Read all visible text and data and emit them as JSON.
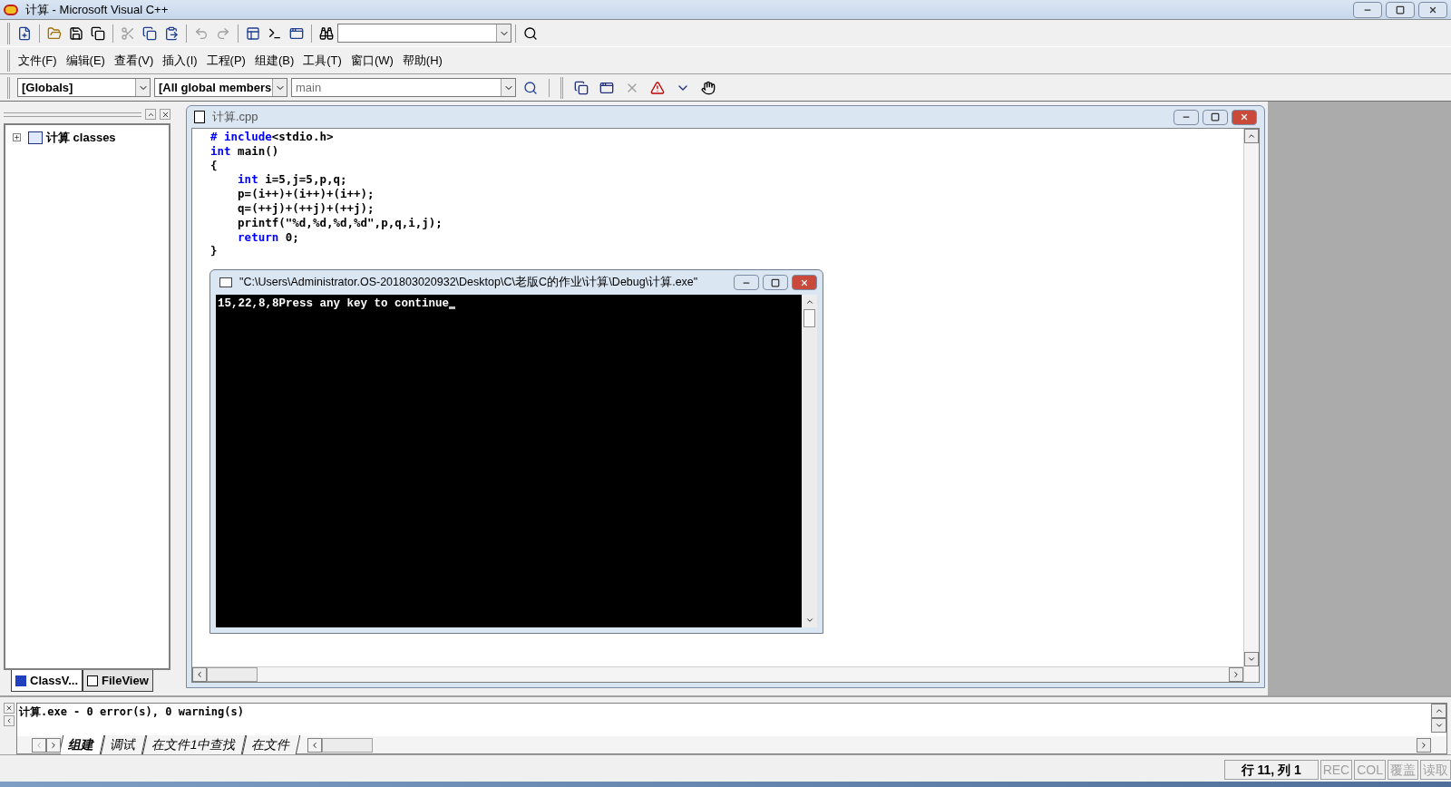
{
  "window": {
    "title": "计算 - Microsoft Visual C++"
  },
  "menu": [
    {
      "label": "文件(F)"
    },
    {
      "label": "编辑(E)"
    },
    {
      "label": "查看(V)"
    },
    {
      "label": "插入(I)"
    },
    {
      "label": "工程(P)"
    },
    {
      "label": "组建(B)"
    },
    {
      "label": "工具(T)"
    },
    {
      "label": "窗口(W)"
    },
    {
      "label": "帮助(H)"
    }
  ],
  "wizard_bar": {
    "class_combo": "[Globals]",
    "filter_combo": "[All global members",
    "function_combo": "main"
  },
  "workspace": {
    "tree": [
      {
        "label": "计算 classes",
        "expanded": false
      }
    ],
    "tabs": [
      {
        "label": "ClassV...",
        "selected": true
      },
      {
        "label": "FileView",
        "selected": false
      }
    ]
  },
  "editor": {
    "title": "计算.cpp",
    "lines": [
      [
        {
          "kind": "keyword",
          "text": "# include"
        },
        {
          "kind": "plain",
          "text": "<stdio.h>"
        }
      ],
      [
        {
          "kind": "keyword",
          "text": "int"
        },
        {
          "kind": "plain",
          "text": " main()"
        }
      ],
      [
        {
          "kind": "plain",
          "text": "{"
        }
      ],
      [
        {
          "kind": "keyword",
          "text": "int",
          "indent": true
        },
        {
          "kind": "plain",
          "text": " i=5,j=5,p,q;"
        }
      ],
      [
        {
          "kind": "plain",
          "text": "p=(i++)+(i++)+(i++);",
          "indent": true
        }
      ],
      [
        {
          "kind": "plain",
          "text": "q=(++j)+(++j)+(++j);",
          "indent": true
        }
      ],
      [
        {
          "kind": "plain",
          "text": "printf(\"%d,%d,%d,%d\",p,q,i,j);",
          "indent": true
        }
      ],
      [
        {
          "kind": "keyword",
          "text": "return",
          "indent": true
        },
        {
          "kind": "plain",
          "text": " 0;"
        }
      ],
      [
        {
          "kind": "plain",
          "text": "}"
        }
      ]
    ]
  },
  "console": {
    "title": "\"C:\\Users\\Administrator.OS-201803020932\\Desktop\\C\\老版C的作业\\计算\\Debug\\计算.exe\"",
    "output": "15,22,8,8Press any key to continue"
  },
  "output": {
    "text": "计算.exe - 0 error(s), 0 warning(s)",
    "tabs": [
      {
        "label": "组建",
        "selected": true
      },
      {
        "label": "调试",
        "selected": false
      },
      {
        "label": "在文件1中查找",
        "selected": false
      },
      {
        "label": "在文件",
        "selected": false
      }
    ]
  },
  "status_bar": {
    "position": "行 11, 列 1",
    "indicators": [
      {
        "label": "REC",
        "disabled": true
      },
      {
        "label": "COL",
        "disabled": true
      },
      {
        "label": "覆盖",
        "disabled": true
      },
      {
        "label": "读取",
        "disabled": true
      }
    ]
  }
}
